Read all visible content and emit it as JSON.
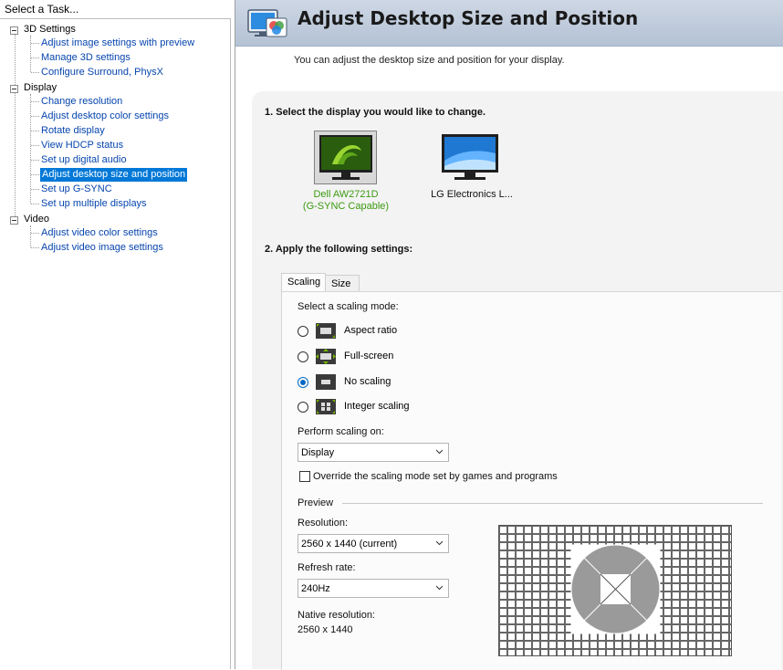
{
  "left_panel": {
    "header": "Select a Task...",
    "categories": [
      {
        "label": "3D Settings",
        "items": [
          {
            "label": "Adjust image settings with preview"
          },
          {
            "label": "Manage 3D settings"
          },
          {
            "label": "Configure Surround, PhysX"
          }
        ]
      },
      {
        "label": "Display",
        "items": [
          {
            "label": "Change resolution"
          },
          {
            "label": "Adjust desktop color settings"
          },
          {
            "label": "Rotate display"
          },
          {
            "label": "View HDCP status"
          },
          {
            "label": "Set up digital audio"
          },
          {
            "label": "Adjust desktop size and position",
            "selected": true
          },
          {
            "label": "Set up G-SYNC"
          },
          {
            "label": "Set up multiple displays"
          }
        ]
      },
      {
        "label": "Video",
        "items": [
          {
            "label": "Adjust video color settings"
          },
          {
            "label": "Adjust video image settings"
          }
        ]
      }
    ]
  },
  "header": {
    "title": "Adjust Desktop Size and Position",
    "subtitle": "You can adjust the desktop size and position for your display."
  },
  "step1": {
    "title": "1. Select the display you would like to change.",
    "displays": [
      {
        "name": "Dell AW2721D",
        "caption": "(G-SYNC Capable)",
        "selected": true
      },
      {
        "name": "LG Electronics L...",
        "selected": false
      }
    ]
  },
  "step2": {
    "title": "2. Apply the following settings:",
    "tabs": [
      {
        "label": "Scaling",
        "active": true
      },
      {
        "label": "Size",
        "active": false
      }
    ],
    "scaling_mode_label": "Select a scaling mode:",
    "scaling_modes": [
      {
        "label": "Aspect ratio",
        "checked": false
      },
      {
        "label": "Full-screen",
        "checked": false
      },
      {
        "label": "No scaling",
        "checked": true
      },
      {
        "label": "Integer scaling",
        "checked": false
      }
    ],
    "perform_on_label": "Perform scaling on:",
    "perform_on_value": "Display",
    "override_label": "Override the scaling mode set by games and programs",
    "override_checked": false,
    "preview_label": "Preview",
    "resolution_label": "Resolution:",
    "resolution_value": "2560 x 1440 (current)",
    "refresh_label": "Refresh rate:",
    "refresh_value": "240Hz",
    "native_label": "Native resolution:",
    "native_value": "2560 x 1440"
  },
  "colors": {
    "link": "#0645ad",
    "selection": "#0078d7",
    "nvidia_green": "#76b900",
    "selected_caption": "#3c9a10",
    "radio_accent": "#0067c0"
  }
}
